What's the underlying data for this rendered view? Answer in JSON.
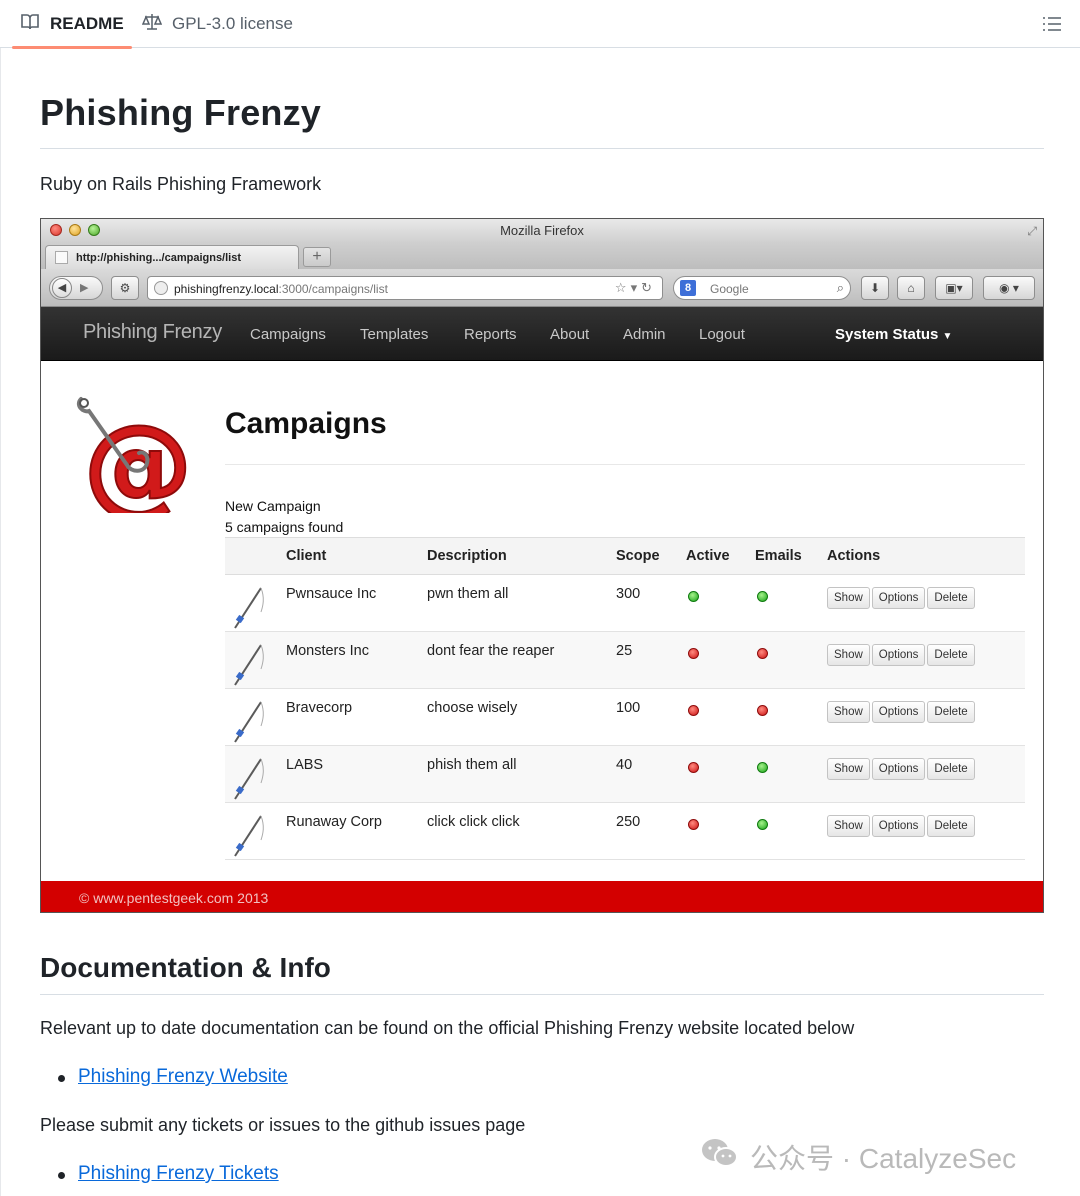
{
  "github": {
    "tabs": [
      {
        "label": "README",
        "icon": "book-icon",
        "active": true
      },
      {
        "label": "GPL-3.0 license",
        "icon": "scale-icon",
        "active": false
      }
    ],
    "toc_icon": "list-icon"
  },
  "readme": {
    "title": "Phishing Frenzy",
    "subtitle": "Ruby on Rails Phishing Framework",
    "doc_heading": "Documentation & Info",
    "doc_text": "Relevant up to date documentation can be found on the official Phishing Frenzy website located below",
    "link1": "Phishing Frenzy Website",
    "tickets_text": "Please submit any tickets or issues to the github issues page",
    "link2": "Phishing Frenzy Tickets"
  },
  "browser": {
    "window_title": "Mozilla Firefox",
    "tab_title": "http://phishing.../campaigns/list",
    "url_host": "phishingfrenzy.local",
    "url_path": ":3000/campaigns/list",
    "search_placeholder": "Google",
    "newtab_label": "+"
  },
  "app": {
    "brand": "Phishing Frenzy",
    "nav": [
      "Campaigns",
      "Templates",
      "Reports",
      "About",
      "Admin",
      "Logout"
    ],
    "system_status": "System Status",
    "page_title": "Campaigns",
    "new_campaign": "New Campaign",
    "count_text": "5 campaigns found",
    "columns": [
      "Client",
      "Description",
      "Scope",
      "Active",
      "Emails",
      "Actions"
    ],
    "action_labels": [
      "Show",
      "Options",
      "Delete"
    ],
    "rows": [
      {
        "client": "Pwnsauce Inc",
        "description": "pwn them all",
        "scope": "300",
        "active": "green",
        "emails": "green"
      },
      {
        "client": "Monsters Inc",
        "description": "dont fear the reaper",
        "scope": "25",
        "active": "red",
        "emails": "red"
      },
      {
        "client": "Bravecorp",
        "description": "choose wisely",
        "scope": "100",
        "active": "red",
        "emails": "red"
      },
      {
        "client": "LABS",
        "description": "phish them all",
        "scope": "40",
        "active": "red",
        "emails": "green"
      },
      {
        "client": "Runaway Corp",
        "description": "click click click",
        "scope": "250",
        "active": "red",
        "emails": "green"
      }
    ],
    "footer": "© www.pentestgeek.com 2013"
  },
  "watermark": {
    "text": "公众号 · CatalyzeSec"
  },
  "colors": {
    "accent": "#0969da",
    "footer_red": "#d30000",
    "tab_underline": "#fd8c73"
  }
}
